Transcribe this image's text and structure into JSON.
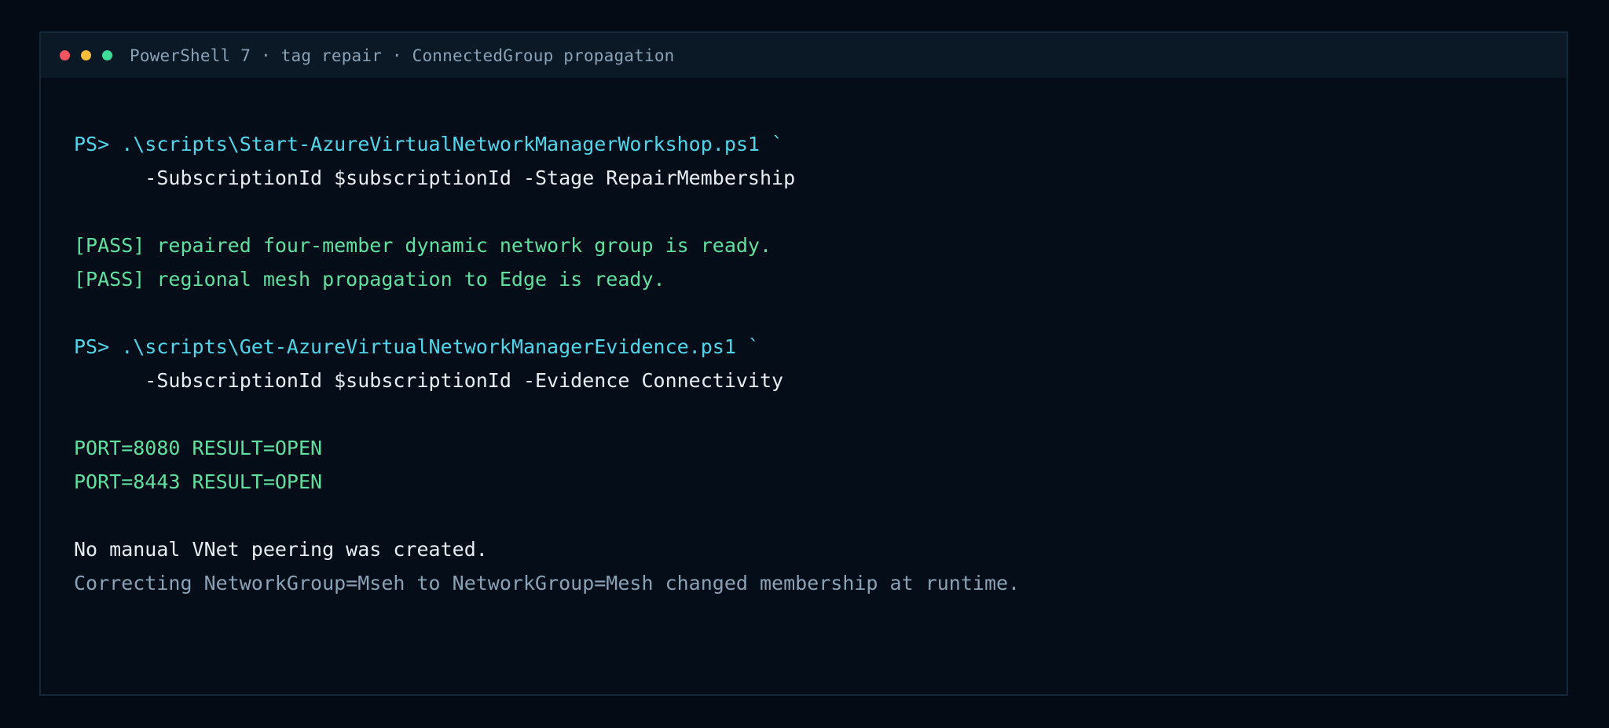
{
  "window": {
    "title": "PowerShell 7 · tag repair · ConnectedGroup propagation",
    "controls": [
      {
        "name": "close",
        "color": "#f0555f"
      },
      {
        "name": "minimize",
        "color": "#f5bd3a"
      },
      {
        "name": "maximize",
        "color": "#3ddc97"
      }
    ]
  },
  "colors": {
    "background": "#050b14",
    "command": "#4fd6ea",
    "pass": "#5fe0a0",
    "text": "#e8edf2",
    "muted": "#8aa2b6"
  },
  "terminal": {
    "lines": [
      {
        "kind": "command",
        "text": "PS> .\\scripts\\Start-AzureVirtualNetworkManagerWorkshop.ps1 `"
      },
      {
        "kind": "text",
        "text": "      -SubscriptionId $subscriptionId -Stage RepairMembership"
      },
      {
        "kind": "blank",
        "text": ""
      },
      {
        "kind": "pass",
        "text": "[PASS] repaired four-member dynamic network group is ready."
      },
      {
        "kind": "pass",
        "text": "[PASS] regional mesh propagation to Edge is ready."
      },
      {
        "kind": "blank",
        "text": ""
      },
      {
        "kind": "command",
        "text": "PS> .\\scripts\\Get-AzureVirtualNetworkManagerEvidence.ps1 `"
      },
      {
        "kind": "text",
        "text": "      -SubscriptionId $subscriptionId -Evidence Connectivity"
      },
      {
        "kind": "blank",
        "text": ""
      },
      {
        "kind": "pass",
        "text": "PORT=8080 RESULT=OPEN"
      },
      {
        "kind": "pass",
        "text": "PORT=8443 RESULT=OPEN"
      },
      {
        "kind": "blank",
        "text": ""
      },
      {
        "kind": "text",
        "text": "No manual VNet peering was created."
      },
      {
        "kind": "muted",
        "text": "Correcting NetworkGroup=Mseh to NetworkGroup=Mesh changed membership at runtime."
      }
    ]
  }
}
